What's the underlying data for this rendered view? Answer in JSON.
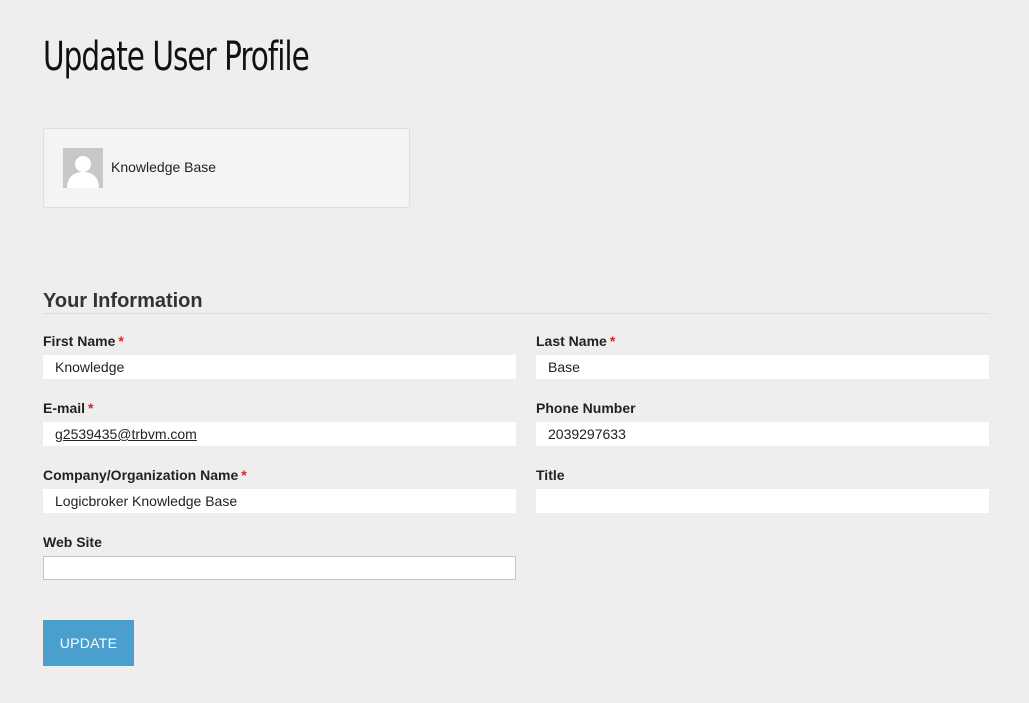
{
  "page": {
    "title": "Update User Profile"
  },
  "user_card": {
    "avatar_icon": "user-silhouette-icon",
    "name": "Knowledge Base"
  },
  "section": {
    "title": "Your Information"
  },
  "fields": {
    "first_name": {
      "label": "First Name",
      "required": "*",
      "value": "Knowledge"
    },
    "last_name": {
      "label": "Last Name",
      "required": "*",
      "value": "Base"
    },
    "email": {
      "label": "E-mail",
      "required": "*",
      "value": "g2539435@trbvm.com"
    },
    "phone": {
      "label": "Phone Number",
      "value": "2039297633"
    },
    "company": {
      "label": "Company/Organization Name",
      "required": "*",
      "value": "Logicbroker Knowledge Base"
    },
    "title": {
      "label": "Title",
      "value": ""
    },
    "website": {
      "label": "Web Site",
      "value": ""
    }
  },
  "actions": {
    "update_label": "UPDATE"
  },
  "colors": {
    "background": "#eeeeee",
    "button": "#4a9fce",
    "required": "#d9242b"
  }
}
